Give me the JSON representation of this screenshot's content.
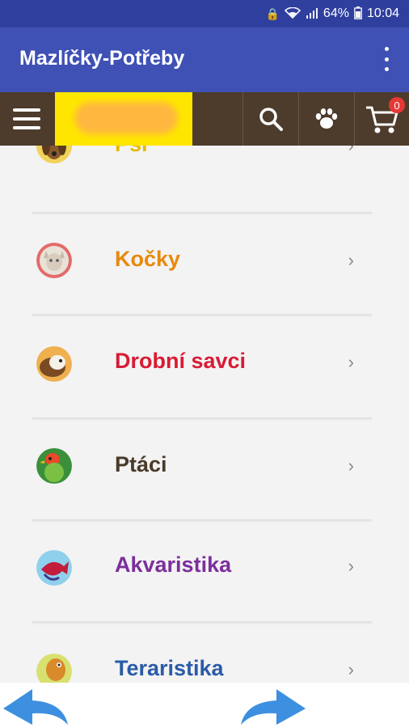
{
  "status": {
    "battery": "64%",
    "time": "10:04"
  },
  "appbar": {
    "title": "Mazlíčky-Potřeby"
  },
  "toolbar": {
    "cart_count": "0"
  },
  "categories": [
    {
      "label": "Psi",
      "color": "#e6b800"
    },
    {
      "label": "Kočky",
      "color": "#e8890c"
    },
    {
      "label": "Drobní savci",
      "color": "#d81b35"
    },
    {
      "label": "Ptáci",
      "color": "#4a3a2a"
    },
    {
      "label": "Akvaristika",
      "color": "#7b2f9c"
    },
    {
      "label": "Teraristika",
      "color": "#2a5ba8"
    }
  ],
  "colors": {
    "statusbar": "#2f3f9e",
    "appbar": "#3f51b5",
    "toolbar": "#4d3b2b",
    "logo": "#ffe600",
    "nav_arrow": "#3d8fe0"
  }
}
